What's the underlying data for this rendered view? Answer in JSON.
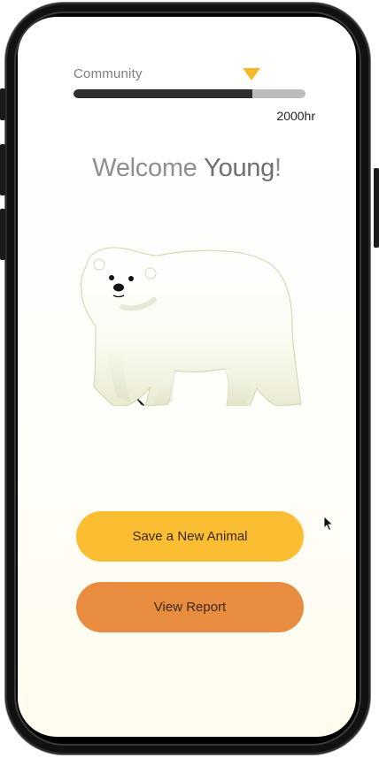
{
  "progress": {
    "label": "Community",
    "hours": "2000hr",
    "fill_fraction": 0.77,
    "fill_color": "#2f2f2f",
    "track_color": "#bdbdbd",
    "marker_color": "#f6b928"
  },
  "welcome": {
    "prefix": "Welcome ",
    "name": "Young",
    "suffix": "!"
  },
  "animal": {
    "icon": "polar-bear-illustration"
  },
  "buttons": {
    "save_label": "Save a New Animal",
    "report_label": "View Report",
    "save_color": "#fbbd32",
    "report_color": "#e88c40"
  }
}
